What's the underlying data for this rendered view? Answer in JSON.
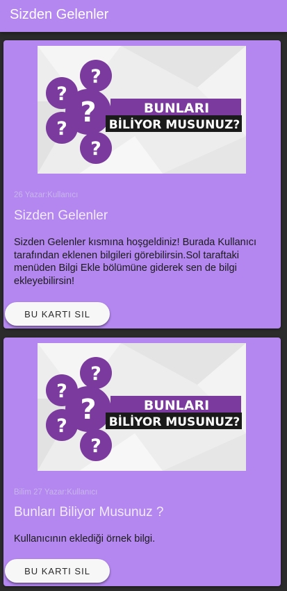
{
  "appbar": {
    "title": "Sizden Gelenler"
  },
  "image": {
    "line1": "BUNLARI",
    "line2": "BİLİYOR MUSUNUZ?",
    "symbol": "?"
  },
  "cards": [
    {
      "meta": "26 Yazar:Kullanıcı",
      "title": "Sizden Gelenler",
      "body": "Sizden Gelenler kısmına hoşgeldiniz! Burada Kullanıcı tarafından eklenen bilgileri görebilirsin.Sol taraftaki menüden Bilgi Ekle bölümüne giderek sen de bilgi ekleyebilirsin!",
      "button": "BU KARTI SIL"
    },
    {
      "meta": "Bilim 27 Yazar:Kullanıcı",
      "title": "Bunları Biliyor Musunuz ?",
      "body": "Kullanıcının eklediği örnek bilgi.",
      "button": "BU KARTI SIL"
    }
  ],
  "colors": {
    "accent": "#b487f0",
    "background": "#2b2b2b",
    "circle": "#7b3a9e",
    "banner_dark": "#1a1a1a"
  }
}
